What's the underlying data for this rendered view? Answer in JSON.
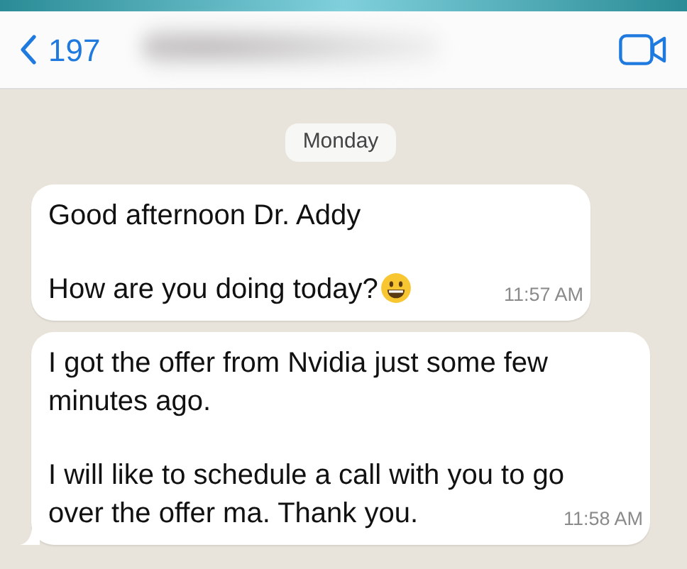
{
  "header": {
    "back_count": "197"
  },
  "date_divider": "Monday",
  "messages": [
    {
      "paragraphs": [
        "Good afternoon Dr. Addy",
        "How are you doing today?"
      ],
      "emoji": true,
      "time": "11:57 AM",
      "tail": false
    },
    {
      "paragraphs": [
        "I got the offer from Nvidia just some few minutes ago.",
        "I will like to schedule a call with you to go over the offer ma. Thank you."
      ],
      "emoji": false,
      "time": "11:58 AM",
      "tail": true
    }
  ]
}
